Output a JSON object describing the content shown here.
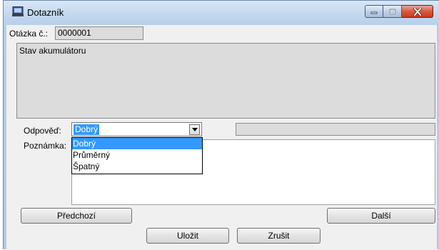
{
  "window": {
    "title": "Dotazník",
    "minimize_icon": "minimize-icon",
    "maximize_icon": "maximize-icon",
    "close_icon": "close-icon"
  },
  "question": {
    "label": "Otázka č.:",
    "number": "0000001",
    "text": "Stav akumulátoru"
  },
  "answer": {
    "label": "Odpověď:",
    "selected": "Dobrý",
    "options": [
      "Dobrý",
      "Průměrný",
      "Špatný"
    ],
    "side_value": ""
  },
  "note": {
    "label": "Poznámka:",
    "value": ""
  },
  "buttons": {
    "previous": "Předchozí",
    "next": "Další",
    "save": "Uložit",
    "cancel": "Zrušit"
  },
  "colors": {
    "selection": "#3399ff",
    "close_button": "#c63c1f"
  }
}
